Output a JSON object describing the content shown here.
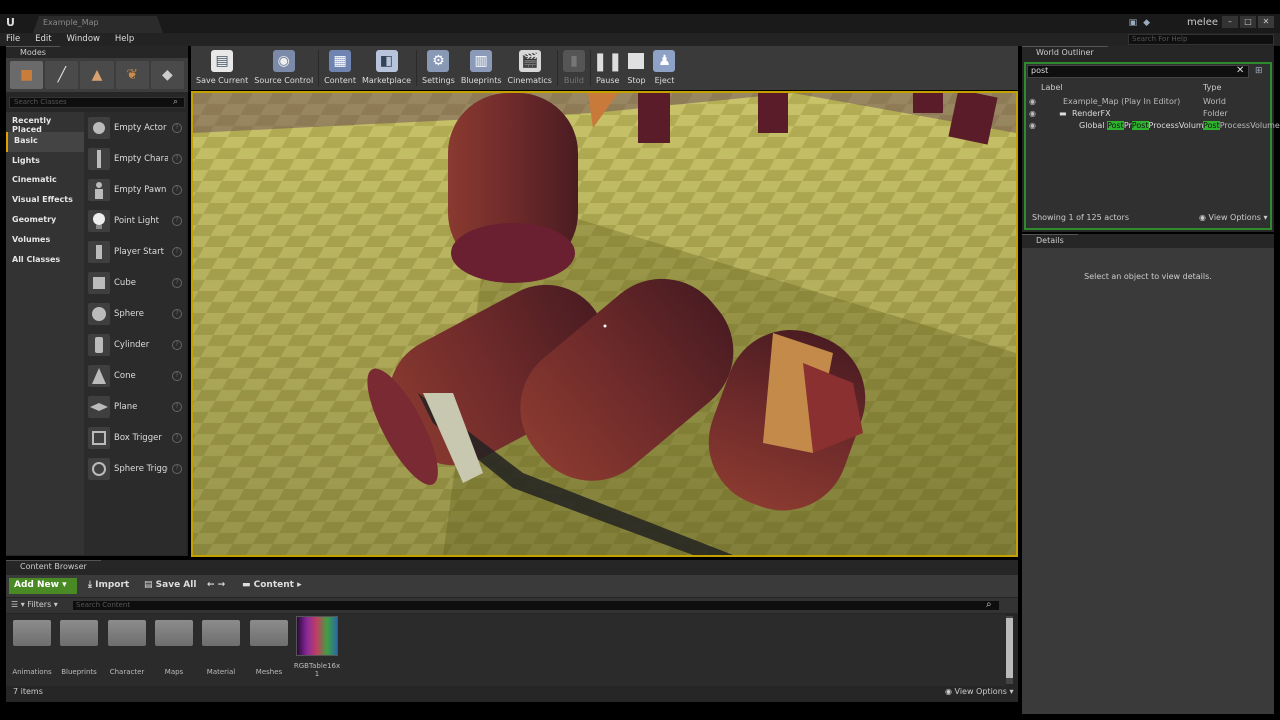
{
  "window": {
    "tab": "Example_Map",
    "project": "melee",
    "help_placeholder": "Search For Help"
  },
  "menu": [
    "File",
    "Edit",
    "Window",
    "Help"
  ],
  "modes": {
    "tab": "Modes",
    "search_placeholder": "Search Classes",
    "categories": [
      "Recently Placed",
      "Basic",
      "Lights",
      "Cinematic",
      "Visual Effects",
      "Geometry",
      "Volumes",
      "All Classes"
    ],
    "items": [
      "Empty Actor",
      "Empty Charac",
      "Empty Pawn",
      "Point Light",
      "Player Start",
      "Cube",
      "Sphere",
      "Cylinder",
      "Cone",
      "Plane",
      "Box Trigger",
      "Sphere Trigge"
    ]
  },
  "toolbar": [
    "Save Current",
    "Source Control",
    "Content",
    "Marketplace",
    "Settings",
    "Blueprints",
    "Cinematics",
    "Build",
    "Pause",
    "Stop",
    "Eject"
  ],
  "outliner": {
    "tab": "World Outliner",
    "filter": "post",
    "col_label": "Label",
    "col_type": "Type",
    "rows": [
      {
        "label": "Example_Map (Play In Editor)",
        "type": "World"
      },
      {
        "label": "RenderFX",
        "type": "Folder"
      }
    ],
    "volume_pre": "Global ",
    "volume_hl1": "Post",
    "volume_mid": "Pr",
    "volume_hl2": "Post",
    "volume_post": "ProcessVolume",
    "volume_type_hl": "Post",
    "volume_type_rest": "ProcessVolume",
    "footer": "Showing 1 of 125 actors",
    "view_options": "View Options"
  },
  "details": {
    "tab": "Details",
    "empty": "Select an object to view details."
  },
  "content_browser": {
    "tab": "Content Browser",
    "add_new": "Add New",
    "import": "Import",
    "save_all": "Save All",
    "path": "Content",
    "filters": "Filters",
    "search_placeholder": "Search Content",
    "assets": [
      "Animations",
      "Blueprints",
      "Character",
      "Maps",
      "Material",
      "Meshes"
    ],
    "texture_name": "RGBTable16x1",
    "count": "7 items",
    "view_options": "View Options"
  }
}
